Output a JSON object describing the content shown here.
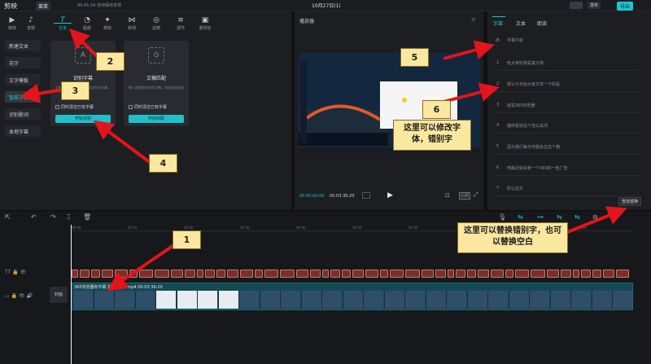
{
  "titlebar": {
    "app": "剪映",
    "menu": "菜单",
    "path": "00:41:34 自动保存本地",
    "doc": "10月27日(1)",
    "share": "发布",
    "export": "导出"
  },
  "toolbar": {
    "tabs": [
      {
        "label": "媒体",
        "icon": "media-icon"
      },
      {
        "label": "音频",
        "icon": "audio-icon"
      },
      {
        "label": "文本",
        "icon": "text-icon"
      },
      {
        "label": "贴纸",
        "icon": "sticker-icon"
      },
      {
        "label": "特效",
        "icon": "effects-icon"
      },
      {
        "label": "转场",
        "icon": "transition-icon"
      },
      {
        "label": "滤镜",
        "icon": "filter-icon"
      },
      {
        "label": "调节",
        "icon": "adjust-icon"
      },
      {
        "label": "素材包",
        "icon": "assets-icon"
      }
    ],
    "active": "文本"
  },
  "sidebar": {
    "items": [
      "新建文本",
      "花字",
      "文字模板",
      "智能字幕",
      "识别歌词",
      "本地字幕"
    ],
    "active": "智能字幕"
  },
  "cards": {
    "recognize": {
      "title": "识别字幕",
      "desc": "识别音视频中的人声，自动生成字幕",
      "check": "同时清空已有字幕",
      "button": "开始识别"
    },
    "match": {
      "title": "文稿匹配",
      "desc": "输入音视频对应的文稿，自动匹配画面",
      "check": "同时清空已有字幕",
      "button": "开始匹配"
    }
  },
  "player": {
    "title": "播放器",
    "current": "00:00:00:00",
    "total": "00:03:36:20"
  },
  "rightpanel": {
    "tabs": [
      "字幕",
      "文本",
      "朗读"
    ],
    "active": "字幕",
    "col_no": "序",
    "col_text": "字幕内容",
    "rows": [
      {
        "n": "1",
        "text": "哈大家好我是童子锅"
      },
      {
        "n": "2",
        "text": "那么今天给大家分享一下的是"
      },
      {
        "n": "3",
        "text": "就是360浏览器"
      },
      {
        "n": "4",
        "text": "播你看双这个怎么关闭"
      },
      {
        "n": "5",
        "text": "因为我们每天可能会在这个箱"
      },
      {
        "n": "6",
        "text": "吧最近就会有一个360的一些广告"
      },
      {
        "n": "7",
        "text": "所以这文"
      }
    ],
    "replace_button": "查找替换"
  },
  "timeline": {
    "ticks": [
      "00:00",
      "00:10",
      "00:20",
      "00:30",
      "00:40",
      "00:50",
      "01:00",
      "01:10",
      "01:20",
      "01:30"
    ],
    "video_label": "360浏览器有字幕 如何关闭?.mp4  00:03:36:20",
    "cover": "封面"
  },
  "annotations": {
    "n1": "1",
    "n2": "2",
    "n3": "3",
    "n4": "4",
    "n5": "5",
    "n6": "6",
    "note_modify": "这里可以修改字体，错别字",
    "note_replace": "这里可以替换错别字，也可以替换空白"
  },
  "colors": {
    "accent": "#20c4d0",
    "annotation_bg": "#fbe8a0",
    "arrow": "#e3141b",
    "subtitle_clip": "#7a2f2a",
    "video_track": "#144a52"
  }
}
